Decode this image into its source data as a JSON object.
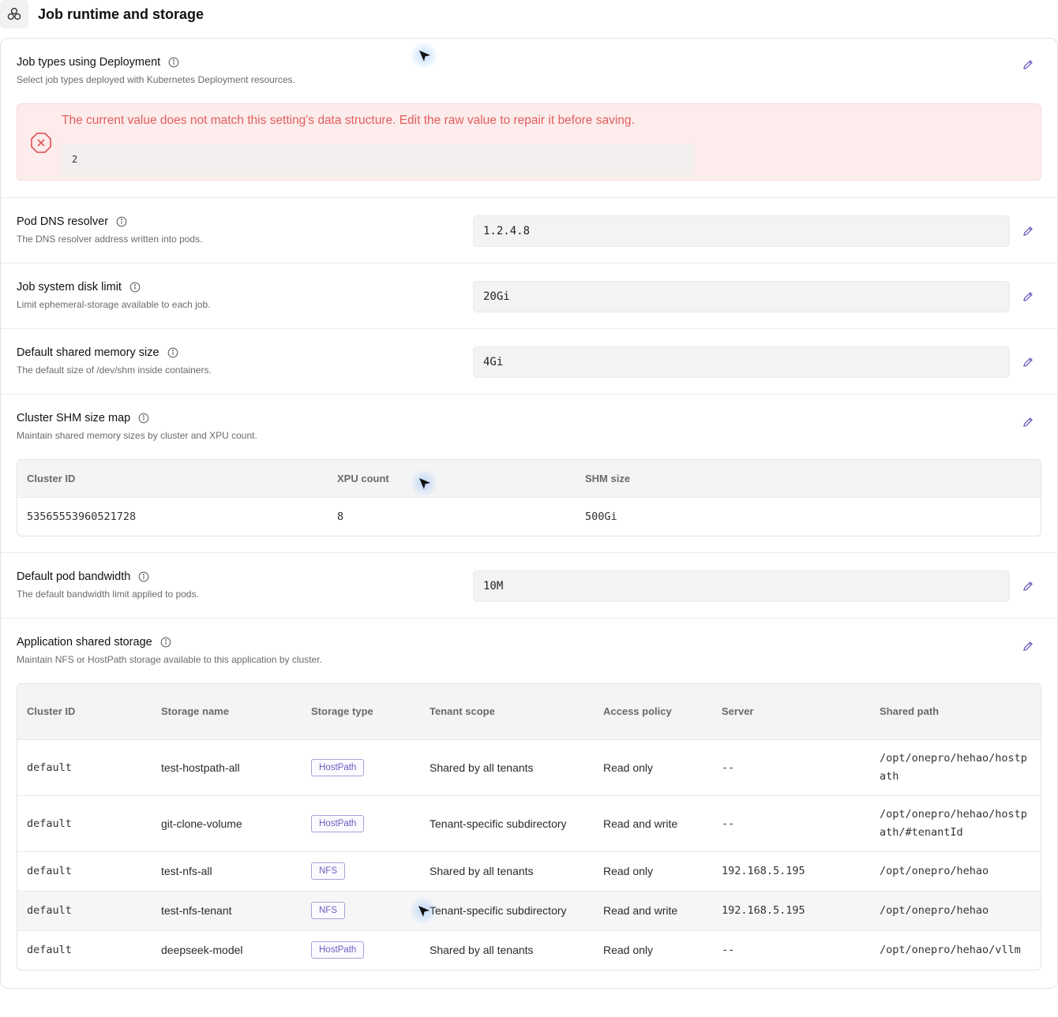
{
  "header": {
    "title": "Job runtime and storage",
    "logo_icon": "cluster-nodes-icon"
  },
  "settings": {
    "job_types": {
      "label": "Job types using Deployment",
      "description": "Select job types deployed with Kubernetes Deployment resources.",
      "error_message": "The current value does not match this setting's data structure. Edit the raw value to repair it before saving.",
      "raw_value": "2"
    },
    "pod_dns": {
      "label": "Pod DNS resolver",
      "description": "The DNS resolver address written into pods.",
      "value": "1.2.4.8"
    },
    "disk_limit": {
      "label": "Job system disk limit",
      "description": "Limit ephemeral-storage available to each job.",
      "value": "20Gi"
    },
    "shm_size": {
      "label": "Default shared memory size",
      "description": "The default size of /dev/shm inside containers.",
      "value": "4Gi"
    },
    "shm_map": {
      "label": "Cluster SHM size map",
      "description": "Maintain shared memory sizes by cluster and XPU count.",
      "columns": [
        "Cluster ID",
        "XPU count",
        "SHM size"
      ],
      "rows": [
        {
          "cluster_id": "53565553960521728",
          "xpu_count": "8",
          "shm_size": "500Gi"
        }
      ]
    },
    "bandwidth": {
      "label": "Default pod bandwidth",
      "description": "The default bandwidth limit applied to pods.",
      "value": "10M"
    },
    "shared_storage": {
      "label": "Application shared storage",
      "description": "Maintain NFS or HostPath storage available to this application by cluster.",
      "columns": [
        "Cluster ID",
        "Storage name",
        "Storage type",
        "Tenant scope",
        "Access policy",
        "Server",
        "Shared path"
      ],
      "rows": [
        {
          "cluster_id": "default",
          "name": "test-hostpath-all",
          "type": "HostPath",
          "scope": "Shared by all tenants",
          "access": "Read only",
          "server": "--",
          "path_line1": "/opt/onepro/hehao/hostp",
          "path_line2": "ath"
        },
        {
          "cluster_id": "default",
          "name": "git-clone-volume",
          "type": "HostPath",
          "scope": "Tenant-specific subdirectory",
          "access": "Read and write",
          "server": "--",
          "path_line1": "/opt/onepro/hehao/hostp",
          "path_line2": "ath/#tenantId"
        },
        {
          "cluster_id": "default",
          "name": "test-nfs-all",
          "type": "NFS",
          "scope": "Shared by all tenants",
          "access": "Read only",
          "server": "192.168.5.195",
          "path_line1": "/opt/onepro/hehao",
          "path_line2": ""
        },
        {
          "cluster_id": "default",
          "name": "test-nfs-tenant",
          "type": "NFS",
          "scope": "Tenant-specific subdirectory",
          "access": "Read and write",
          "server": "192.168.5.195",
          "path_line1": "/opt/onepro/hehao",
          "path_line2": ""
        },
        {
          "cluster_id": "default",
          "name": "deepseek-model",
          "type": "HostPath",
          "scope": "Shared by all tenants",
          "access": "Read only",
          "server": "--",
          "path_line1": "/opt/onepro/hehao/vllm",
          "path_line2": ""
        }
      ]
    }
  },
  "colors": {
    "accent": "#6b5fc0",
    "error_text": "#e25e5e",
    "error_bg": "#fdecec"
  }
}
